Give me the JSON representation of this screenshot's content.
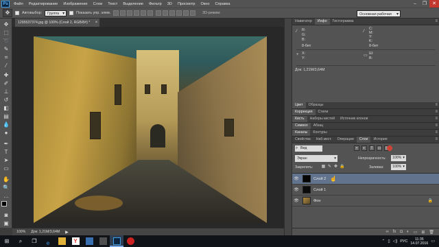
{
  "app": {
    "logo": "Ps"
  },
  "menu": [
    "Файл",
    "Редактирование",
    "Изображение",
    "Слои",
    "Текст",
    "Выделение",
    "Фильтр",
    "3D",
    "Просмотр",
    "Окно",
    "Справка"
  ],
  "options": {
    "autoselect_label": "Автовыбор:",
    "autoselect_value": "Группа",
    "show_controls_label": "Показать упр. элем.",
    "mode3d_label": "3D-режим:",
    "workspace": "Основная рабочая среда"
  },
  "document": {
    "tab_title": "1295537374.jpg @ 100% (Слой 2, RGB/8#) *"
  },
  "status": {
    "zoom": "100%",
    "doc_size": "Док: 1,21М/3,64М"
  },
  "panels": {
    "top_tabs": [
      "Навигатор",
      "Инфо",
      "Гистограмма"
    ],
    "info": {
      "r": "R:",
      "g": "G:",
      "b": "B:",
      "c": "C:",
      "m": "M:",
      "y": "Y:",
      "k": "K:",
      "bit_left": "8-бит",
      "bit_right": "8-бит",
      "x": "X:",
      "y_coord": "Y:",
      "w": "Ш:",
      "h": "В:",
      "doc": "Док: 1,21М/3,64М"
    },
    "color_tabs": [
      "Цвет",
      "Образцы"
    ],
    "correction_tabs": [
      "Коррекция",
      "Стили"
    ],
    "brush_tabs": [
      "Кисть",
      "Наборы кистей",
      "Источник клонов"
    ],
    "symbol_tabs": [
      "Символ",
      "Абзац"
    ],
    "channel_tabs": [
      "Каналы",
      "Контуры"
    ],
    "layers_tabs": [
      "Свойства",
      "Наб.мкст.",
      "Операции",
      "Слои",
      "История"
    ]
  },
  "layers": {
    "kind": "Вид",
    "blend": "Экран",
    "opacity_label": "Непрозрачность:",
    "opacity": "100%",
    "lock_label": "Закрепить:",
    "fill_label": "Заливка:",
    "fill": "100%",
    "items": [
      {
        "name": "Слой 2",
        "selected": true,
        "thumb": "#050505"
      },
      {
        "name": "Слой 1",
        "selected": false,
        "thumb": "#0b0b0b"
      },
      {
        "name": "Фон",
        "selected": false,
        "thumb": "#8a6d3a",
        "locked": true
      }
    ]
  },
  "taskbar": {
    "lang": "РУС",
    "time": "11:35",
    "date": "14.07.2016"
  },
  "colors": {
    "selection": "#62738d",
    "panel": "#535353",
    "canvas_bg": "#282828"
  }
}
